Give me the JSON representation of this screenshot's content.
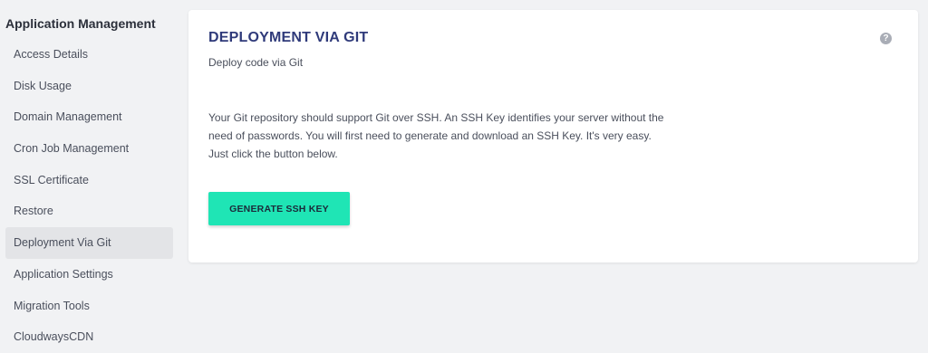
{
  "sidebar": {
    "title": "Application Management",
    "items": [
      {
        "label": "Access Details"
      },
      {
        "label": "Disk Usage"
      },
      {
        "label": "Domain Management"
      },
      {
        "label": "Cron Job Management"
      },
      {
        "label": "SSL Certificate"
      },
      {
        "label": "Restore"
      },
      {
        "label": "Deployment Via Git",
        "active": true
      },
      {
        "label": "Application Settings"
      },
      {
        "label": "Migration Tools"
      },
      {
        "label": "CloudwaysCDN"
      }
    ]
  },
  "card": {
    "title": "DEPLOYMENT VIA GIT",
    "subtitle": "Deploy code via Git",
    "help_icon": "?",
    "description_lines": [
      "Your Git repository should support Git over SSH. An SSH Key identifies your server without the",
      "need of passwords. You will first need to generate and download an SSH Key. It's very easy.",
      "Just click the button below."
    ],
    "button_label": "GENERATE SSH KEY"
  },
  "colors": {
    "accent_button": "#1fe5b5",
    "title": "#2f3a7a",
    "background": "#f1f2f4",
    "active_item": "#e3e4e7"
  },
  "icons": {
    "help": "help-circle-icon"
  }
}
